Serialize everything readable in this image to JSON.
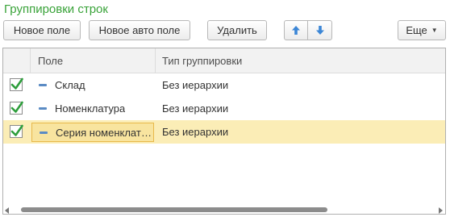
{
  "title": "Группировки строк",
  "toolbar": {
    "new_field": "Новое поле",
    "new_auto_field": "Новое авто поле",
    "delete": "Удалить",
    "move_up_icon": "arrow-up-icon",
    "move_down_icon": "arrow-down-icon",
    "more": "Еще"
  },
  "grid": {
    "columns": [
      "Поле",
      "Тип группировки"
    ],
    "rows": [
      {
        "checked": true,
        "field": "Склад",
        "type": "Без иерархии",
        "selected": false
      },
      {
        "checked": true,
        "field": "Номенклатура",
        "type": "Без иерархии",
        "selected": false
      },
      {
        "checked": true,
        "field": "Серия номенклатуры",
        "type": "Без иерархии",
        "selected": true
      }
    ]
  },
  "colors": {
    "title": "#3aa33a",
    "selected_row": "#fbedb6",
    "check_mark": "#2e9e3c",
    "arrow_icon": "#3b86d6"
  }
}
